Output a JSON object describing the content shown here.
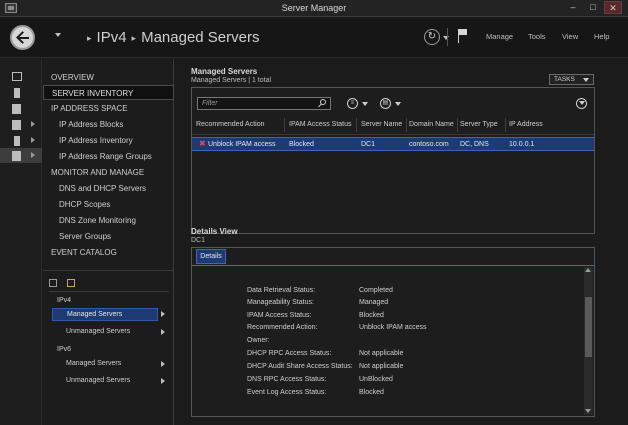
{
  "window": {
    "title": "Server Manager",
    "min": "–",
    "max": "□",
    "close": "✕"
  },
  "header": {
    "crumbs": [
      "IPv4",
      "Managed Servers"
    ],
    "refresh_icon": "refresh-icon",
    "flag_icon": "notification-flag-icon",
    "menu": {
      "manage": "Manage",
      "tools": "Tools",
      "view": "View",
      "help": "Help"
    }
  },
  "nav": {
    "items": [
      {
        "label": "OVERVIEW",
        "kind": "h"
      },
      {
        "label": "SERVER INVENTORY",
        "kind": "h",
        "selected": true
      },
      {
        "label": "IP ADDRESS SPACE",
        "kind": "h"
      },
      {
        "label": "IP Address Blocks",
        "kind": "s"
      },
      {
        "label": "IP Address Inventory",
        "kind": "s"
      },
      {
        "label": "IP Address Range Groups",
        "kind": "s"
      },
      {
        "label": "MONITOR AND MANAGE",
        "kind": "h"
      },
      {
        "label": "DNS and DHCP Servers",
        "kind": "s"
      },
      {
        "label": "DHCP Scopes",
        "kind": "s"
      },
      {
        "label": "DNS Zone Monitoring",
        "kind": "s"
      },
      {
        "label": "Server Groups",
        "kind": "s"
      },
      {
        "label": "EVENT CATALOG",
        "kind": "h"
      }
    ],
    "tree": {
      "ipv4": "IPv4",
      "ipv4_managed": "Managed Servers",
      "ipv4_unmanaged": "Unmanaged Servers",
      "ipv6": "IPv6",
      "ipv6_managed": "Managed Servers",
      "ipv6_unmanaged": "Unmanaged Servers"
    }
  },
  "managed_servers": {
    "title": "Managed Servers",
    "subtitle": "Managed Servers | 1 total",
    "tasks_label": "TASKS",
    "filter_placeholder": "Filter",
    "columns": [
      "Recommended Action",
      "IPAM Access Status",
      "Server Name",
      "Domain Name",
      "Server Type",
      "IP Address"
    ],
    "rows": [
      {
        "action": "Unblock IPAM access",
        "status": "Blocked",
        "server": "DC1",
        "domain": "contoso.com",
        "type": "DC, DNS",
        "ip": "10.0.0.1"
      }
    ]
  },
  "details": {
    "title": "Details View",
    "subtitle": "DC1",
    "tab": "Details",
    "props": [
      {
        "label": "Data Retrieval Status:",
        "value": "Completed"
      },
      {
        "label": "Manageability Status:",
        "value": "Managed"
      },
      {
        "label": "IPAM Access Status:",
        "value": "Blocked"
      },
      {
        "label": "Recommended Action:",
        "value": "Unblock IPAM access"
      },
      {
        "label": "Owner:",
        "value": ""
      },
      {
        "label": "DHCP RPC Access Status:",
        "value": "Not applicable"
      },
      {
        "label": "DHCP Audit Share Access Status:",
        "value": "Not applicable"
      },
      {
        "label": "DNS RPC Access Status:",
        "value": "UnBlocked"
      },
      {
        "label": "Event Log Access Status:",
        "value": "Blocked"
      }
    ]
  }
}
